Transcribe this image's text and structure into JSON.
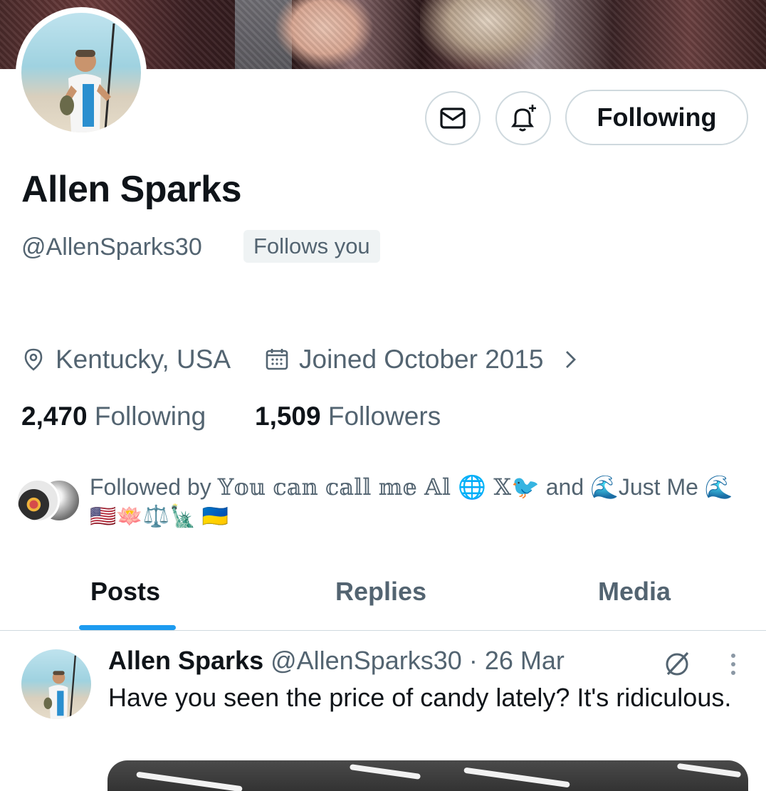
{
  "profile": {
    "display_name": "Allen Sparks",
    "handle": "@AllenSparks30",
    "follows_you": "Follows you",
    "location": "Kentucky, USA",
    "joined": "Joined October 2015",
    "following_count": "2,470",
    "following_label": "Following",
    "followers_count": "1,509",
    "followers_label": "Followers"
  },
  "actions": {
    "following_button": "Following",
    "message_icon": "mail-icon",
    "notify_icon": "bell-plus-icon"
  },
  "followed_by": {
    "prefix": "Followed by",
    "name1": "𝕐𝕠𝕦 𝕔𝕒𝕟 𝕔𝕒𝕝𝕝 𝕞𝕖 𝔸𝕝 🌐 𝕏🐦",
    "conjunction": "and",
    "name2": "🌊Just Me 🌊",
    "emoji_line": "🇺🇸🪷⚖️🗽 🇺🇦"
  },
  "tabs": [
    {
      "label": "Posts",
      "active": true
    },
    {
      "label": "Replies",
      "active": false
    },
    {
      "label": "Media",
      "active": false
    }
  ],
  "post": {
    "name": "Allen Sparks",
    "handle": "@AllenSparks30",
    "separator": "·",
    "date": "26 Mar",
    "text": "Have you seen the price of candy lately? It's ridiculous."
  },
  "colors": {
    "accent": "#1d9bf0",
    "text_primary": "#0f1419",
    "text_secondary": "#536471",
    "border": "#cfd9de"
  }
}
